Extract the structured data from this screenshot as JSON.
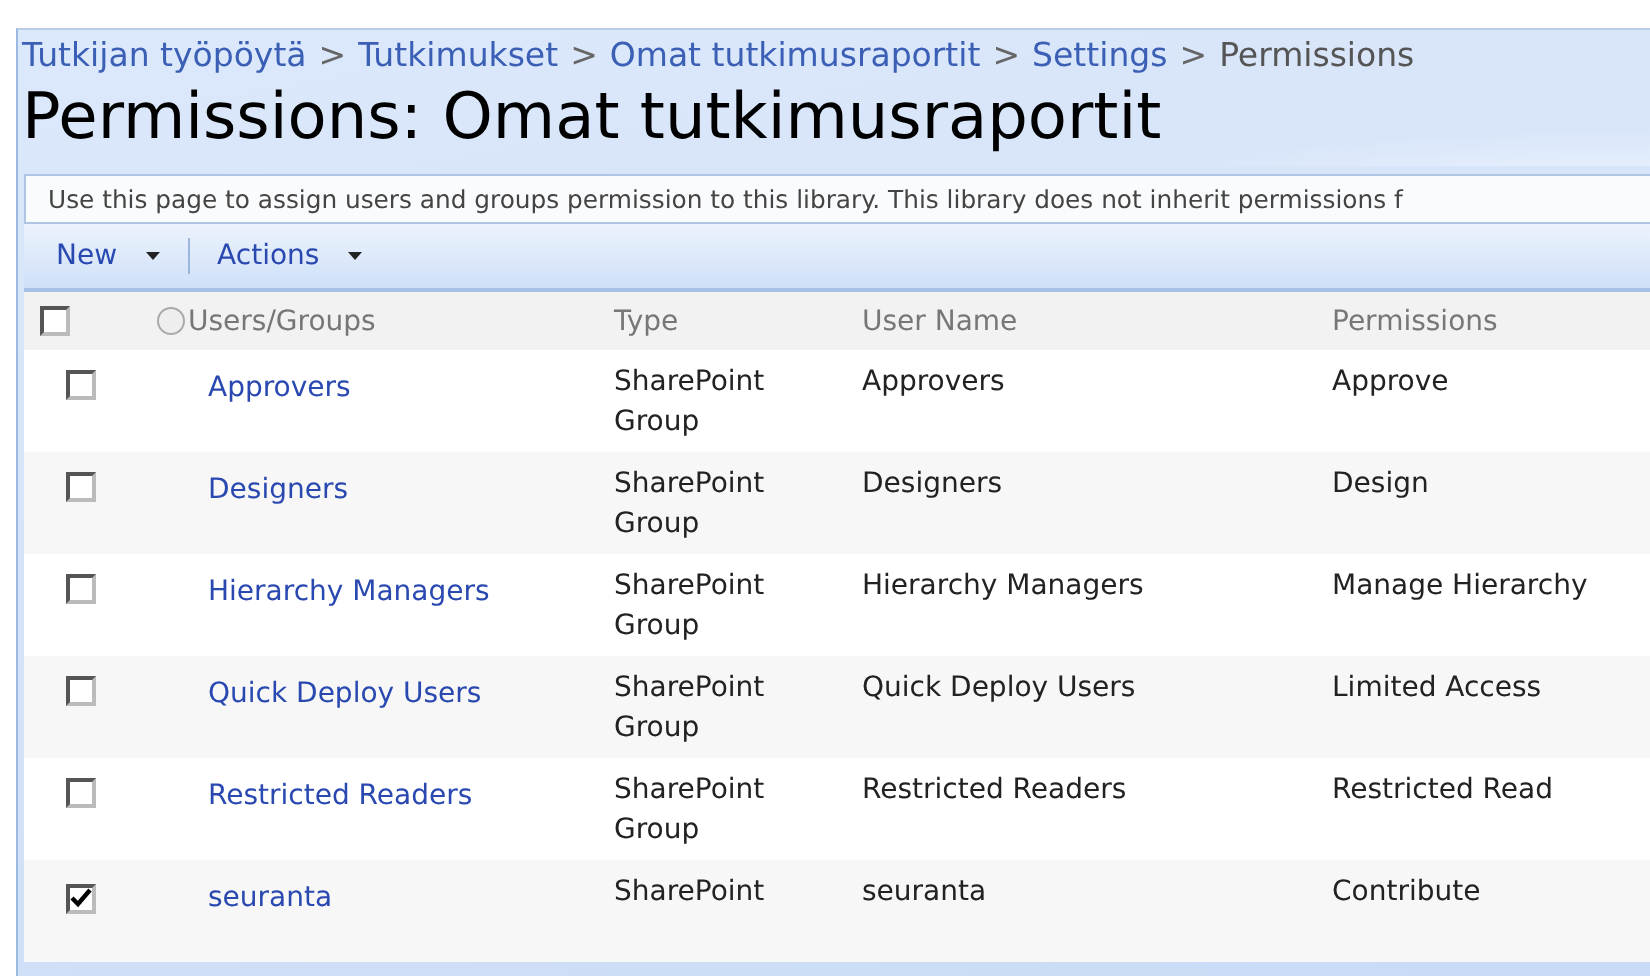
{
  "breadcrumb": [
    {
      "label": "Tutkijan työpöytä",
      "link": true
    },
    {
      "label": "Tutkimukset",
      "link": true
    },
    {
      "label": "Omat tutkimusraportit",
      "link": true
    },
    {
      "label": "Settings",
      "link": true
    },
    {
      "label": "Permissions",
      "link": false
    }
  ],
  "separator": ">",
  "title": "Permissions: Omat tutkimusraportit",
  "description": "Use this page to assign users and groups permission to this library. This library does not inherit permissions f",
  "toolbar": [
    {
      "label": "New",
      "menu": true
    },
    {
      "label": "Actions",
      "menu": true
    }
  ],
  "table": {
    "select_all": {
      "checked": false
    },
    "columns": [
      "Users/Groups",
      "Type",
      "User Name",
      "Permissions"
    ],
    "rows": [
      {
        "checked": false,
        "name": "Approvers",
        "type": "SharePoint Group",
        "user_name": "Approvers",
        "permissions": "Approve"
      },
      {
        "checked": false,
        "name": "Designers",
        "type": "SharePoint Group",
        "user_name": "Designers",
        "permissions": "Design"
      },
      {
        "checked": false,
        "name": "Hierarchy Managers",
        "type": "SharePoint Group",
        "user_name": "Hierarchy Managers",
        "permissions": "Manage Hierarchy"
      },
      {
        "checked": false,
        "name": "Quick Deploy Users",
        "type": "SharePoint Group",
        "user_name": "Quick Deploy Users",
        "permissions": "Limited Access"
      },
      {
        "checked": false,
        "name": "Restricted Readers",
        "type": "SharePoint Group",
        "user_name": "Restricted Readers",
        "permissions": "Restricted Read"
      },
      {
        "checked": true,
        "name": "seuranta",
        "type": "SharePoint",
        "user_name": "seuranta",
        "permissions": "Contribute"
      }
    ]
  }
}
